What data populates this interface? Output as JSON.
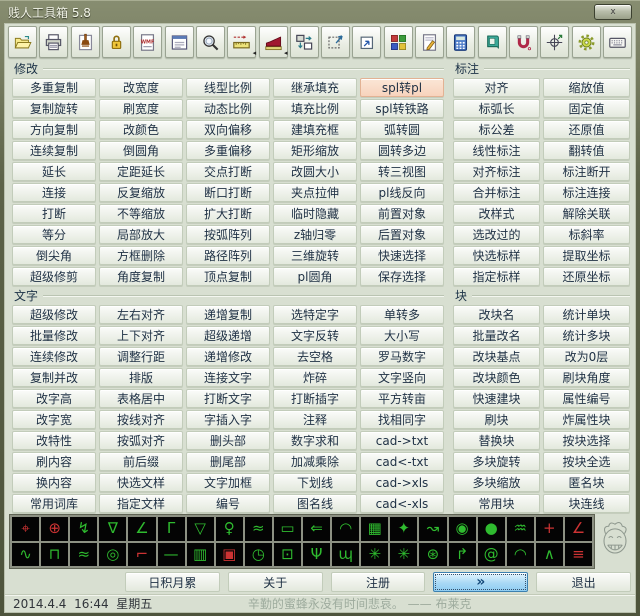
{
  "window": {
    "title": "贱人工具箱 5.8",
    "close_glyph": "x"
  },
  "toolbar": {
    "icons": [
      "open-file",
      "print",
      "purge-brush",
      "lock",
      "wmf-export",
      "notes-window",
      "zoom-magnifier",
      "measure-ruler",
      "area-chart",
      "move-copy",
      "select-filter",
      "shortcut-window",
      "color-blocks",
      "edit-document",
      "calculator",
      "notebook",
      "magnet",
      "ucs-crosshair",
      "settings-gear",
      "keyboard"
    ]
  },
  "highlight": "spl转pl",
  "sections": {
    "modify": {
      "label": "修改",
      "buttons": [
        "多重复制",
        "改宽度",
        "线型比例",
        "继承填充",
        "spl转pl",
        "复制旋转",
        "刷宽度",
        "动态比例",
        "填充比例",
        "spl转铁路",
        "方向复制",
        "改颜色",
        "双向偏移",
        "建填充框",
        "弧转圆",
        "连续复制",
        "倒圆角",
        "多重偏移",
        "矩形缩放",
        "圆转多边",
        "延长",
        "定距延长",
        "交点打断",
        "改圆大小",
        "转三视图",
        "连接",
        "反复缩放",
        "断口打断",
        "夹点拉伸",
        "pl线反向",
        "打断",
        "不等缩放",
        "扩大打断",
        "临时隐藏",
        "前置对象",
        "等分",
        "局部放大",
        "按弧阵列",
        "z轴归零",
        "后置对象",
        "倒尖角",
        "方框删除",
        "路径阵列",
        "三维旋转",
        "快速选择",
        "超级修剪",
        "角度复制",
        "顶点复制",
        "pl圆角",
        "保存选择"
      ]
    },
    "dimension": {
      "label": "标注",
      "buttons": [
        "对齐",
        "缩放值",
        "标弧长",
        "固定值",
        "标公差",
        "还原值",
        "线性标注",
        "翻转值",
        "对齐标注",
        "标注断开",
        "合并标注",
        "标注连接",
        "改样式",
        "解除关联",
        "选改过的",
        "标斜率",
        "快选标样",
        "提取坐标",
        "指定标样",
        "还原坐标"
      ]
    },
    "text": {
      "label": "文字",
      "buttons": [
        "超级修改",
        "左右对齐",
        "递增复制",
        "选特定字",
        "单转多",
        "批量修改",
        "上下对齐",
        "超级递增",
        "文字反转",
        "大小写",
        "连续修改",
        "调整行距",
        "递增修改",
        "去空格",
        "罗马数字",
        "复制并改",
        "排版",
        "连接文字",
        "炸碎",
        "文字竖向",
        "改字高",
        "表格居中",
        "打断文字",
        "打断插字",
        "平方转亩",
        "改字宽",
        "按线对齐",
        "字插入字",
        "注释",
        "找相同字",
        "改特性",
        "按弧对齐",
        "删头部",
        "数字求和",
        "cad->txt",
        "刷内容",
        "前后缀",
        "删尾部",
        "加减乘除",
        "cad<-txt",
        "换内容",
        "快选文样",
        "文字加框",
        "下划线",
        "cad->xls",
        "常用词库",
        "指定文样",
        "编号",
        "图名线",
        "cad<-xls"
      ]
    },
    "block": {
      "label": "块",
      "buttons": [
        "改块名",
        "统计单块",
        "批量改名",
        "统计多块",
        "改块基点",
        "改为0层",
        "改块颜色",
        "刷块角度",
        "快速建块",
        "属性编号",
        "刷块",
        "炸属性块",
        "替换块",
        "按块选择",
        "多块旋转",
        "按块全选",
        "多块缩放",
        "匿名块",
        "常用块",
        "块连线"
      ]
    }
  },
  "strip": {
    "tiles": [
      {
        "name": "target-cross",
        "g": "⌖",
        "c": "#cc3333"
      },
      {
        "name": "circle-cross",
        "g": "⊕",
        "c": "#cc3333"
      },
      {
        "name": "lightning",
        "g": "↯",
        "c": "#2fbb2f"
      },
      {
        "name": "xxx-triangle",
        "g": "∇",
        "c": "#2fbb2f"
      },
      {
        "name": "slope-hatch",
        "g": "∠",
        "c": "#2fbb2f"
      },
      {
        "name": "gamma-marks",
        "g": "Γ",
        "c": "#2fbb2f"
      },
      {
        "name": "check-triangle",
        "g": "▽",
        "c": "#2fbb2f"
      },
      {
        "name": "survey-point",
        "g": "♀",
        "c": "#2fbb2f"
      },
      {
        "name": "wave-box",
        "g": "≈",
        "c": "#2fbb2f"
      },
      {
        "name": "callout-bubble",
        "g": "▭",
        "c": "#2fbb2f"
      },
      {
        "name": "left-arrow",
        "g": "⇐",
        "c": "#2fbb2f"
      },
      {
        "name": "curve-chart",
        "g": "◠",
        "c": "#2fbb2f"
      },
      {
        "name": "table-grid",
        "g": "▦",
        "c": "#2fbb2f"
      },
      {
        "name": "four-point-star",
        "g": "✦",
        "c": "#2fbb2f"
      },
      {
        "name": "stairs",
        "g": "↝",
        "c": "#2fbb2f"
      },
      {
        "name": "gauge-needle",
        "g": "◉",
        "c": "#2fbb2f"
      },
      {
        "name": "dot",
        "g": "●",
        "c": "#2fbb2f"
      },
      {
        "name": "coil",
        "g": "♒",
        "c": "#2fbb2f"
      },
      {
        "name": "red-cross",
        "g": "+",
        "c": "#cc3333"
      },
      {
        "name": "angle-lines",
        "g": "∠",
        "c": "#cc3333"
      },
      {
        "name": "sine-wave",
        "g": "∿",
        "c": "#2fbb2f"
      },
      {
        "name": "square-wave",
        "g": "⊓",
        "c": "#2fbb2f"
      },
      {
        "name": "small-wave",
        "g": "≈",
        "c": "#2fbb2f"
      },
      {
        "name": "concentric-circles",
        "g": "◎",
        "c": "#2fbb2f"
      },
      {
        "name": "weld-symbol",
        "g": "⌐",
        "c": "#cc3333"
      },
      {
        "name": "dash",
        "g": "—",
        "c": "#2fbb2f"
      },
      {
        "name": "spring",
        "g": "▥",
        "c": "#2fbb2f"
      },
      {
        "name": "red-square",
        "g": "▣",
        "c": "#cc3333"
      },
      {
        "name": "clock",
        "g": "◷",
        "c": "#2fbb2f"
      },
      {
        "name": "dot-box",
        "g": "⊡",
        "c": "#2fbb2f"
      },
      {
        "name": "branch",
        "g": "Ψ",
        "c": "#2fbb2f"
      },
      {
        "name": "noise-wave",
        "g": "ɰ",
        "c": "#2fbb2f"
      },
      {
        "name": "gear-a",
        "g": "✳",
        "c": "#2fbb2f"
      },
      {
        "name": "gear-b",
        "g": "✳",
        "c": "#2fbb2f"
      },
      {
        "name": "star-circle",
        "g": "⊛",
        "c": "#2fbb2f"
      },
      {
        "name": "step-line",
        "g": "↱",
        "c": "#2fbb2f"
      },
      {
        "name": "spiral",
        "g": "@",
        "c": "#2fbb2f"
      },
      {
        "name": "arc-gauge",
        "g": "◠",
        "c": "#2fbb2f"
      },
      {
        "name": "caret-arc",
        "g": "∧",
        "c": "#2fbb2f"
      },
      {
        "name": "double-lines",
        "g": "≡",
        "c": "#cc3333"
      }
    ]
  },
  "bottom": {
    "buttons": [
      "日积月累",
      "关于",
      "注册",
      "»",
      "退出"
    ],
    "focus_index": 3
  },
  "statusbar": {
    "datetime": "2014.4.4  16:44  星期五",
    "quote": "辛勤的蜜蜂永没有时间悲哀。 —— 布莱克"
  }
}
